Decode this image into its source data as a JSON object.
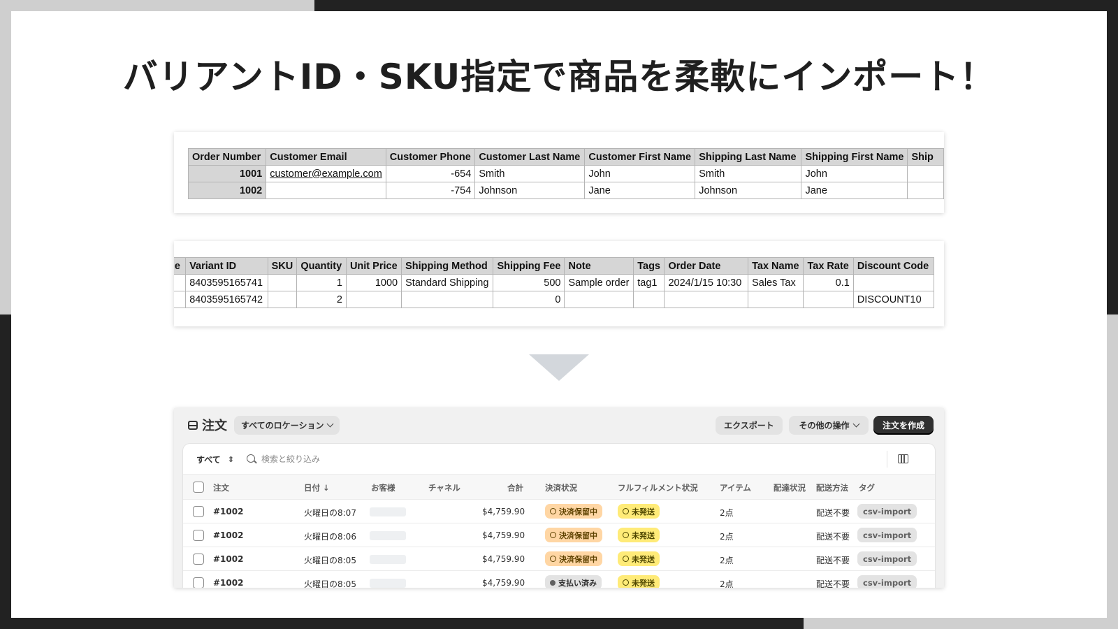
{
  "headline": "バリアントID・SKU指定で商品を柔軟にインポート！",
  "sheet1": {
    "headers": [
      "Order Number",
      "Customer Email",
      "Customer Phone",
      "Customer Last Name",
      "Customer First Name",
      "Shipping Last Name",
      "Shipping First Name",
      "Ship"
    ],
    "rows": [
      [
        "1001",
        "customer@example.com",
        "-654",
        "Smith",
        "John",
        "Smith",
        "John",
        ""
      ],
      [
        "1002",
        "",
        "-754",
        "Johnson",
        "Jane",
        "Johnson",
        "Jane",
        ""
      ]
    ]
  },
  "sheet2": {
    "headers": [
      "de",
      "Variant ID",
      "SKU",
      "Quantity",
      "Unit Price",
      "Shipping Method",
      "Shipping Fee",
      "Note",
      "Tags",
      "Order Date",
      "Tax Name",
      "Tax Rate",
      "Discount Code"
    ],
    "rows": [
      [
        "",
        "8403595165741",
        "",
        "1",
        "1000",
        "Standard Shipping",
        "500",
        "Sample order",
        "tag1",
        "2024/1/15 10:30",
        "Sales Tax",
        "0.1",
        ""
      ],
      [
        "",
        "8403595165742",
        "",
        "2",
        "",
        "",
        "0",
        "",
        "",
        "",
        "",
        "",
        "DISCOUNT10"
      ]
    ]
  },
  "app": {
    "title": "注文",
    "location_label": "すべてのロケーション",
    "export_label": "エクスポート",
    "more_actions_label": "その他の操作",
    "create_order_label": "注文を作成",
    "filter_tab": "すべて",
    "search_placeholder": "検索と絞り込み",
    "columns": {
      "order": "注文",
      "date": "日付 ↓",
      "customer": "お客様",
      "channel": "チャネル",
      "total": "合計",
      "payment_status": "決済状況",
      "fulfillment_status": "フルフィルメント状況",
      "items": "アイテム",
      "delivery_status": "配達状況",
      "delivery_method": "配送方法",
      "tags": "タグ"
    },
    "orders": [
      {
        "id": "#1002",
        "date": "火曜日の8:07",
        "total": "$4,759.90",
        "payment": "決済保留中",
        "fulfillment": "未発送",
        "items": "2点",
        "delivery_method": "配送不要",
        "tag": "csv-import"
      },
      {
        "id": "#1002",
        "date": "火曜日の8:06",
        "total": "$4,759.90",
        "payment": "決済保留中",
        "fulfillment": "未発送",
        "items": "2点",
        "delivery_method": "配送不要",
        "tag": "csv-import"
      },
      {
        "id": "#1002",
        "date": "火曜日の8:05",
        "total": "$4,759.90",
        "payment": "決済保留中",
        "fulfillment": "未発送",
        "items": "2点",
        "delivery_method": "配送不要",
        "tag": "csv-import"
      },
      {
        "id": "#1002",
        "date": "火曜日の8:05",
        "total": "$4,759.90",
        "payment": "支払い済み",
        "fulfillment": "未発送",
        "items": "2点",
        "delivery_method": "配送不要",
        "tag": "csv-import"
      }
    ]
  },
  "colors": {
    "payment_pending_bg": "#ffd6a4",
    "fulfillment_unfulfilled_bg": "#ffeb78",
    "primary_button": "#303030"
  }
}
